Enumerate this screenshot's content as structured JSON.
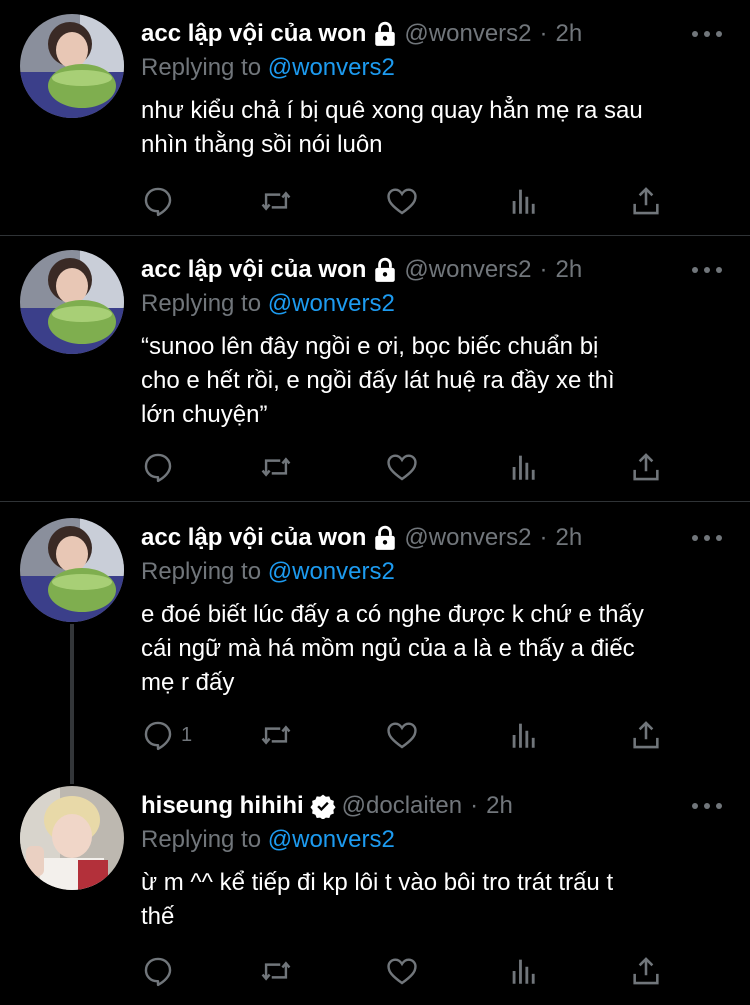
{
  "tweets": [
    {
      "display_name": "acc lập vội của won",
      "handle": "@wonvers2",
      "time": "2h",
      "replying_prefix": "Replying to",
      "replying_to": "@wonvers2",
      "text_lines": [
        "như kiểu chả í bị quê xong quay hẳn mẹ ra sau",
        "nhìn thằng sồi nói luôn"
      ],
      "reply_count": ""
    },
    {
      "display_name": "acc lập vội của won",
      "handle": "@wonvers2",
      "time": "2h",
      "replying_prefix": "Replying to",
      "replying_to": "@wonvers2",
      "text_lines": [
        "“sunoo lên đây ngồi e ơi, bọc biếc chuẩn bị",
        "cho e hết rồi, e ngồi đấy lát huệ ra đầy xe thì",
        "lớn chuyện”"
      ],
      "reply_count": ""
    },
    {
      "display_name": "acc lập vội của won",
      "handle": "@wonvers2",
      "time": "2h",
      "replying_prefix": "Replying to",
      "replying_to": "@wonvers2",
      "text_lines": [
        "e đoé biết lúc đấy a có nghe được k chứ e thấy",
        "cái ngữ mà há mồm ngủ của a là e thấy a điếc",
        "mẹ r đấy"
      ],
      "reply_count": "1"
    },
    {
      "display_name": "hiseung hihihi",
      "handle": "@doclaiten",
      "time": "2h",
      "replying_prefix": "Replying to",
      "replying_to": "@wonvers2",
      "text_lines": [
        "ừ m ^^ kể tiếp đi kp lôi t vào bôi tro trát trấu t",
        "thế"
      ],
      "reply_count": ""
    }
  ],
  "separator": "·",
  "colors": {
    "background": "#000000",
    "text": "#e7e9ea",
    "muted": "#71767b",
    "link": "#1d9bf0",
    "divider": "#2f3336"
  },
  "icons": [
    "reply-icon",
    "retweet-icon",
    "like-icon",
    "analytics-icon",
    "share-icon",
    "more-icon",
    "lock-icon",
    "verified-icon"
  ]
}
